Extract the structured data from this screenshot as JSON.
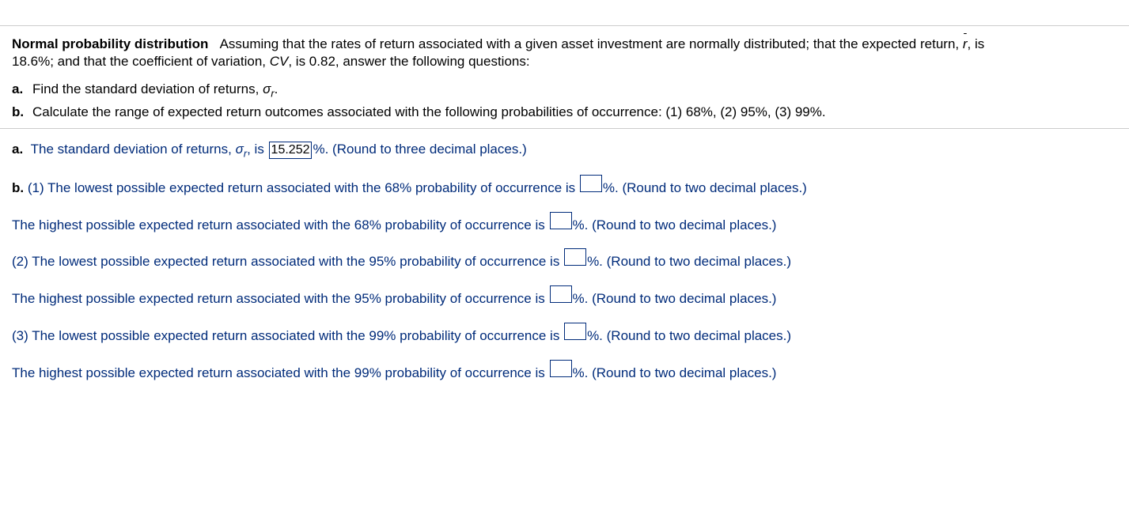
{
  "topic_label": "Normal probability distribution",
  "intro_line1_a": "Assuming that the rates of return associated with a given asset investment are normally distributed; that the expected return, ",
  "intro_line1_b": ", is",
  "intro_line2": "18.6%; and that the coefficient of variation, ",
  "intro_cv": "CV",
  "intro_line2b": ", is 0.82, answer the following questions:",
  "q_a_label": "a.",
  "q_a_text_pre": "Find the standard deviation of returns, ",
  "q_a_text_post": ".",
  "q_b_label": "b.",
  "q_b_text": "Calculate the range of expected return outcomes associated with the following probabilities of occurrence: (1) 68%, (2) 95%, (3) 99%.",
  "ans_a_label": "a.",
  "ans_a_pre": "The standard deviation of returns, ",
  "ans_a_mid": ", is ",
  "ans_a_value": "15.252",
  "ans_a_post": "%.  ",
  "hint_3dp": "(Round to three decimal places.)",
  "hint_2dp": "(Round to two decimal places.)",
  "ans_b_label": "b.",
  "b1_low": " (1) The lowest possible expected return associated with the 68% probability of occurrence is ",
  "b1_high": "The highest possible expected return associated with the 68% probability of occurrence is ",
  "b2_low": "(2) The lowest possible expected return associated with the 95% probability of occurrence is ",
  "b2_high": "The highest possible expected return associated with the 95% probability of occurrence is ",
  "b3_low": "(3) The lowest possible expected return associated with the 99% probability of occurrence is ",
  "b3_high": "The highest possible expected return associated with the 99% probability of occurrence is ",
  "pct_suffix": "%.  "
}
